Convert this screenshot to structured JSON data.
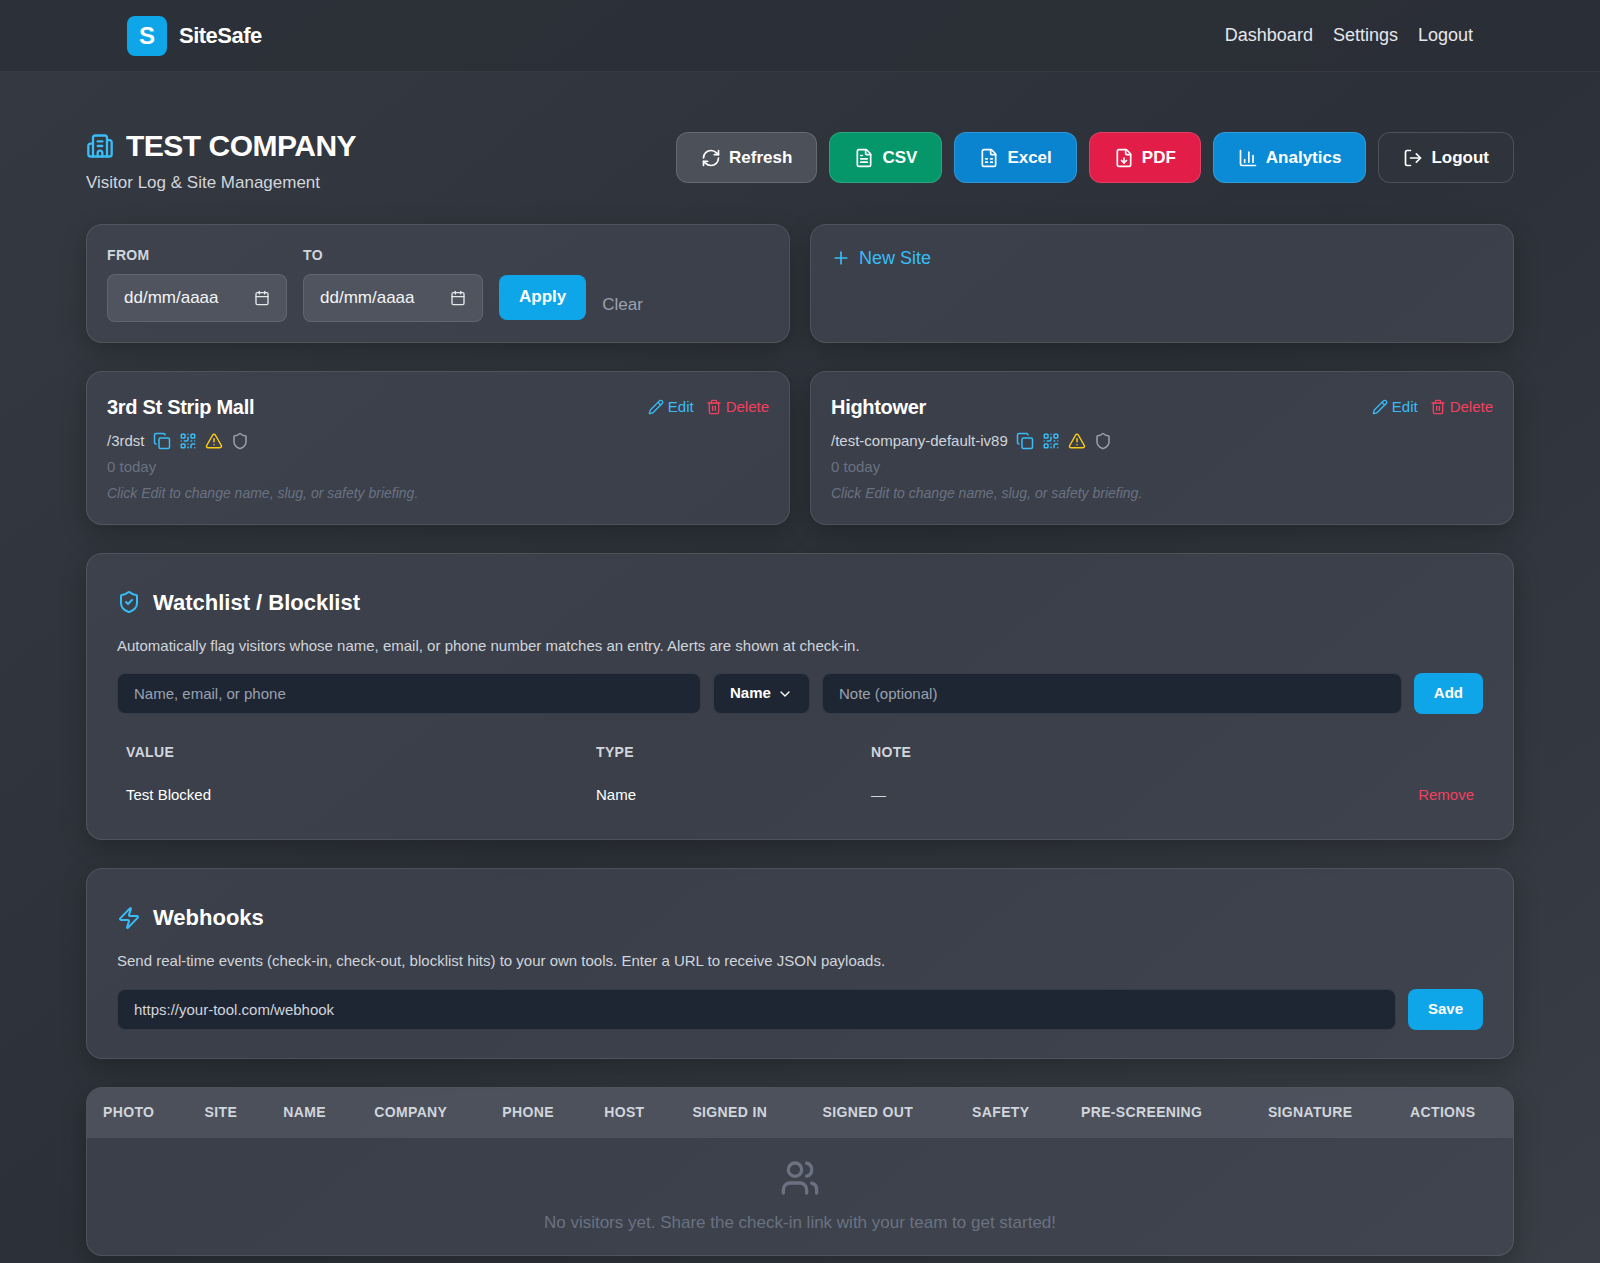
{
  "nav": {
    "brand_letter": "S",
    "brand": "SiteSafe",
    "links": [
      "Dashboard",
      "Settings",
      "Logout"
    ]
  },
  "header": {
    "title": "TEST COMPANY",
    "subtitle": "Visitor Log & Site Management",
    "buttons": [
      {
        "label": "Refresh",
        "color": "#4b5059",
        "kind": "refresh"
      },
      {
        "label": "CSV",
        "color": "#059669",
        "kind": "csv"
      },
      {
        "label": "Excel",
        "color": "#0b84d0",
        "kind": "excel"
      },
      {
        "label": "PDF",
        "color": "#e11d48",
        "kind": "pdf"
      },
      {
        "label": "Analytics",
        "color": "#0b8bd6",
        "kind": "analytics"
      },
      {
        "label": "Logout",
        "color": "#2f333b",
        "kind": "logout"
      }
    ]
  },
  "filter": {
    "from_label": "FROM",
    "to_label": "TO",
    "from_placeholder": "dd/mm/aaaa",
    "to_placeholder": "dd/mm/aaaa",
    "apply": "Apply",
    "clear": "Clear"
  },
  "new_site": {
    "label": "New Site"
  },
  "sites": [
    {
      "name": "3rd St Strip Mall",
      "slug": "/3rdst",
      "count": "0 today",
      "hint": "Click Edit to change name, slug, or safety briefing.",
      "edit": "Edit",
      "delete": "Delete"
    },
    {
      "name": "Hightower",
      "slug": "/test-company-default-iv89",
      "count": "0 today",
      "hint": "Click Edit to change name, slug, or safety briefing.",
      "edit": "Edit",
      "delete": "Delete"
    }
  ],
  "watchlist": {
    "title": "Watchlist / Blocklist",
    "description": "Automatically flag visitors whose name, email, or phone number matches an entry. Alerts are shown at check-in.",
    "value_placeholder": "Name, email, or phone",
    "type_selected": "Name",
    "note_placeholder": "Note (optional)",
    "add": "Add",
    "columns": [
      "VALUE",
      "TYPE",
      "NOTE"
    ],
    "rows": [
      {
        "value": "Test Blocked",
        "type": "Name",
        "note": "—",
        "action": "Remove"
      }
    ]
  },
  "webhooks": {
    "title": "Webhooks",
    "description": "Send real-time events (check-in, check-out, blocklist hits) to your own tools. Enter a URL to receive JSON payloads.",
    "placeholder": "https://your-tool.com/webhook",
    "save": "Save"
  },
  "visitors": {
    "columns": [
      "PHOTO",
      "SITE",
      "NAME",
      "COMPANY",
      "PHONE",
      "HOST",
      "SIGNED IN",
      "SIGNED OUT",
      "SAFETY",
      "PRE-SCREENING",
      "SIGNATURE",
      "ACTIONS"
    ],
    "empty": "No visitors yet. Share the check-in link with your team to get started!"
  }
}
